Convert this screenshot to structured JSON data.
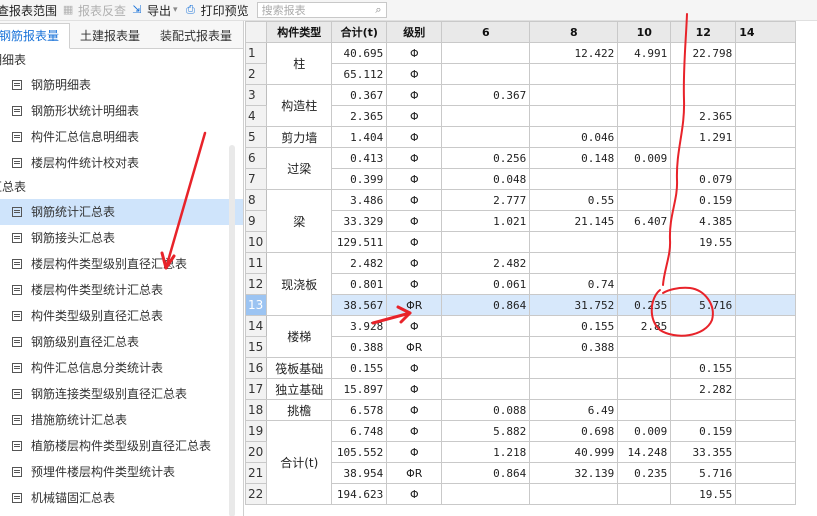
{
  "toolbar": {
    "scope_label": "查报表范围",
    "reverse_label": "报表反查",
    "export_label": "导出",
    "print_label": "打印预览",
    "search_placeholder": "搜索报表"
  },
  "left_panel": {
    "tabs": [
      "钢筋报表量",
      "土建报表量",
      "装配式报表量"
    ],
    "groups": [
      {
        "label": "明细表",
        "items": [
          "钢筋明细表",
          "钢筋形状统计明细表",
          "构件汇总信息明细表",
          "楼层构件统计校对表"
        ]
      },
      {
        "label": "汇总表",
        "items": [
          "钢筋统计汇总表",
          "钢筋接头汇总表",
          "楼层构件类型级别直径汇总表",
          "楼层构件类型统计汇总表",
          "构件类型级别直径汇总表",
          "钢筋级别直径汇总表",
          "构件汇总信息分类统计表",
          "钢筋连接类型级别直径汇总表",
          "措施筋统计汇总表",
          "植筋楼层构件类型级别直径汇总表",
          "预埋件楼层构件类型统计表",
          "机械锚固汇总表"
        ]
      }
    ],
    "selected_item": "钢筋统计汇总表"
  },
  "grid": {
    "headers": [
      "构件类型",
      "合计(t)",
      "级别",
      "6",
      "8",
      "10",
      "12",
      "14"
    ],
    "rows": [
      {
        "n": "1",
        "type": "柱",
        "span": 2,
        "total": "40.695",
        "grade": "Φ",
        "c6": "",
        "c8": "12.422",
        "c10": "4.991",
        "c12": "22.798"
      },
      {
        "n": "2",
        "total": "65.112",
        "grade": "Φ",
        "c6": "",
        "c8": "",
        "c10": "",
        "c12": ""
      },
      {
        "n": "3",
        "type": "构造柱",
        "span": 2,
        "total": "0.367",
        "grade": "Φ",
        "c6": "0.367",
        "c8": "",
        "c10": "",
        "c12": ""
      },
      {
        "n": "4",
        "total": "2.365",
        "grade": "Φ",
        "c6": "",
        "c8": "",
        "c10": "",
        "c12": "2.365"
      },
      {
        "n": "5",
        "type": "剪力墙",
        "span": 1,
        "total": "1.404",
        "grade": "Φ",
        "c6": "",
        "c8": "0.046",
        "c10": "",
        "c12": "1.291"
      },
      {
        "n": "6",
        "type": "过梁",
        "span": 2,
        "total": "0.413",
        "grade": "Φ",
        "c6": "0.256",
        "c8": "0.148",
        "c10": "0.009",
        "c12": ""
      },
      {
        "n": "7",
        "total": "0.399",
        "grade": "Φ",
        "c6": "0.048",
        "c8": "",
        "c10": "",
        "c12": "0.079"
      },
      {
        "n": "8",
        "type": "梁",
        "span": 3,
        "total": "3.486",
        "grade": "Φ",
        "c6": "2.777",
        "c8": "0.55",
        "c10": "",
        "c12": "0.159"
      },
      {
        "n": "9",
        "total": "33.329",
        "grade": "Φ",
        "c6": "1.021",
        "c8": "21.145",
        "c10": "6.407",
        "c12": "4.385"
      },
      {
        "n": "10",
        "total": "129.511",
        "grade": "Φ",
        "c6": "",
        "c8": "",
        "c10": "",
        "c12": "19.55"
      },
      {
        "n": "11",
        "type": "现浇板",
        "span": 3,
        "total": "2.482",
        "grade": "Φ",
        "c6": "2.482",
        "c8": "",
        "c10": "",
        "c12": ""
      },
      {
        "n": "12",
        "total": "0.801",
        "grade": "Φ",
        "c6": "0.061",
        "c8": "0.74",
        "c10": "",
        "c12": ""
      },
      {
        "n": "13",
        "total": "38.567",
        "grade": "ΦR",
        "c6": "0.864",
        "c8": "31.752",
        "c10": "0.235",
        "c12": "5.716",
        "selected": true
      },
      {
        "n": "14",
        "type": "楼梯",
        "span": 2,
        "total": "3.928",
        "grade": "Φ",
        "c6": "",
        "c8": "0.155",
        "c10": "2.85",
        "c12": ""
      },
      {
        "n": "15",
        "total": "0.388",
        "grade": "ΦR",
        "c6": "",
        "c8": "0.388",
        "c10": "",
        "c12": ""
      },
      {
        "n": "16",
        "type": "筏板基础",
        "span": 1,
        "total": "0.155",
        "grade": "Φ",
        "c6": "",
        "c8": "",
        "c10": "",
        "c12": "0.155"
      },
      {
        "n": "17",
        "type": "独立基础",
        "span": 1,
        "total": "15.897",
        "grade": "Φ",
        "c6": "",
        "c8": "",
        "c10": "",
        "c12": "2.282"
      },
      {
        "n": "18",
        "type": "挑檐",
        "span": 1,
        "total": "6.578",
        "grade": "Φ",
        "c6": "0.088",
        "c8": "6.49",
        "c10": "",
        "c12": ""
      },
      {
        "n": "19",
        "type": "合计(t)",
        "span": 4,
        "total": "6.748",
        "grade": "Φ",
        "c6": "5.882",
        "c8": "0.698",
        "c10": "0.009",
        "c12": "0.159"
      },
      {
        "n": "20",
        "total": "105.552",
        "grade": "Φ",
        "c6": "1.218",
        "c8": "40.999",
        "c10": "14.248",
        "c12": "33.355"
      },
      {
        "n": "21",
        "total": "38.954",
        "grade": "ΦR",
        "c6": "0.864",
        "c8": "32.139",
        "c10": "0.235",
        "c12": "5.716"
      },
      {
        "n": "22",
        "total": "194.623",
        "grade": "Φ",
        "c6": "",
        "c8": "",
        "c10": "",
        "c12": "19.55"
      }
    ]
  },
  "annotations": {
    "color": "#e8232a"
  }
}
